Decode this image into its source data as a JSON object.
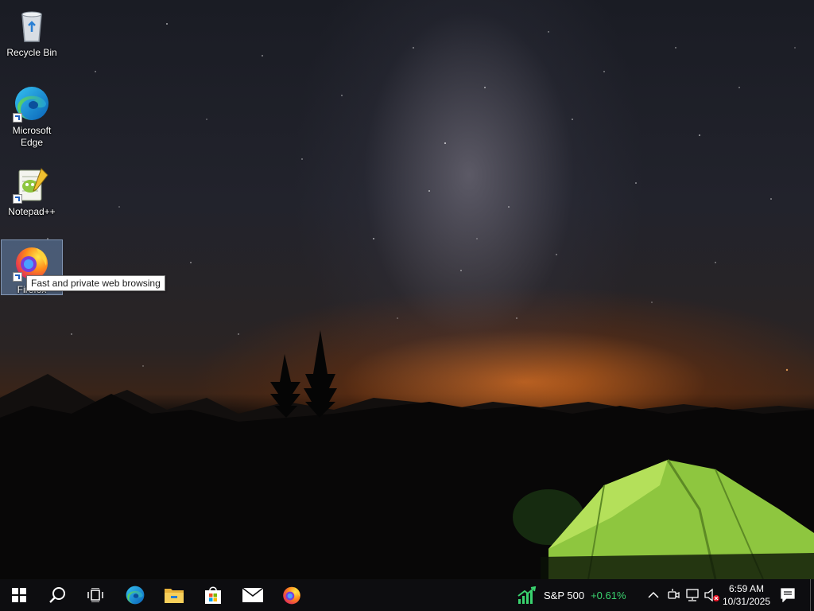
{
  "desktop": {
    "icons": [
      {
        "label": "Recycle Bin",
        "icon": "recycle-bin-icon"
      },
      {
        "label": "Microsoft Edge",
        "icon": "edge-icon"
      },
      {
        "label": "Notepad++",
        "icon": "notepad-plus-plus-icon"
      },
      {
        "label": "Firefox",
        "icon": "firefox-icon",
        "selected": true
      }
    ],
    "tooltip": "Fast and private web browsing"
  },
  "taskbar": {
    "pinned": [
      {
        "name": "start-button",
        "icon": "windows-icon"
      },
      {
        "name": "search-button",
        "icon": "search-icon"
      },
      {
        "name": "task-view-button",
        "icon": "task-view-icon"
      },
      {
        "name": "edge-taskbar-button",
        "icon": "edge-icon"
      },
      {
        "name": "file-explorer-button",
        "icon": "folder-icon"
      },
      {
        "name": "store-button",
        "icon": "store-icon"
      },
      {
        "name": "mail-button",
        "icon": "mail-icon"
      },
      {
        "name": "firefox-taskbar-button",
        "icon": "firefox-icon"
      }
    ],
    "widget": {
      "name": "S&P 500",
      "change": "+0.61%",
      "trend_color": "#3ad36f"
    },
    "tray": {
      "time": "6:59 AM",
      "date": "10/31/2025",
      "icons": [
        "chevron-up-icon",
        "meet-now-icon",
        "network-icon",
        "volume-muted-icon",
        "notification-icon"
      ]
    }
  },
  "colors": {
    "taskbar": "#0d0d10",
    "accent": "#3ad36f"
  }
}
